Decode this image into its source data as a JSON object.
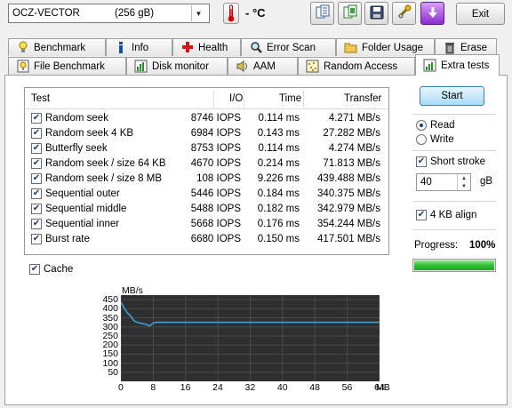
{
  "drive": {
    "name": "OCZ-VECTOR",
    "size": "(256 gB)"
  },
  "temperature": "- °C",
  "toolbar": {
    "icons": [
      "copy-text-icon",
      "copy-screenshot-icon",
      "save-icon",
      "options-icon",
      "download-icon"
    ],
    "exit_label": "Exit"
  },
  "tabs_row1": [
    "Benchmark",
    "Info",
    "Health",
    "Error Scan",
    "Folder Usage",
    "Erase"
  ],
  "tabs_row2": [
    "File Benchmark",
    "Disk monitor",
    "AAM",
    "Random Access",
    "Extra tests"
  ],
  "active_tab": "Extra tests",
  "table": {
    "headers": [
      "Test",
      "I/O",
      "Time",
      "Transfer"
    ],
    "rows": [
      {
        "checked": true,
        "name": "Random seek",
        "io": "8746 IOPS",
        "time": "0.114 ms",
        "transfer": "4.271 MB/s"
      },
      {
        "checked": true,
        "name": "Random seek 4 KB",
        "io": "6984 IOPS",
        "time": "0.143 ms",
        "transfer": "27.282 MB/s"
      },
      {
        "checked": true,
        "name": "Butterfly seek",
        "io": "8753 IOPS",
        "time": "0.114 ms",
        "transfer": "4.274 MB/s"
      },
      {
        "checked": true,
        "name": "Random seek / size 64 KB",
        "io": "4670 IOPS",
        "time": "0.214 ms",
        "transfer": "71.813 MB/s"
      },
      {
        "checked": true,
        "name": "Random seek / size 8 MB",
        "io": "108 IOPS",
        "time": "9.226 ms",
        "transfer": "439.488 MB/s"
      },
      {
        "checked": true,
        "name": "Sequential outer",
        "io": "5446 IOPS",
        "time": "0.184 ms",
        "transfer": "340.375 MB/s"
      },
      {
        "checked": true,
        "name": "Sequential middle",
        "io": "5488 IOPS",
        "time": "0.182 ms",
        "transfer": "342.979 MB/s"
      },
      {
        "checked": true,
        "name": "Sequential inner",
        "io": "5668 IOPS",
        "time": "0.176 ms",
        "transfer": "354.244 MB/s"
      },
      {
        "checked": true,
        "name": "Burst rate",
        "io": "6680 IOPS",
        "time": "0.150 ms",
        "transfer": "417.501 MB/s"
      }
    ]
  },
  "cache": {
    "label": "Cache",
    "checked": true
  },
  "controls": {
    "start_label": "Start",
    "read_label": "Read",
    "write_label": "Write",
    "mode": "read",
    "short_stroke_label": "Short stroke",
    "short_stroke_checked": true,
    "short_stroke_value": "40",
    "short_stroke_unit": "gB",
    "align_label": "4 KB align",
    "align_checked": true,
    "progress_label": "Progress:",
    "progress_text": "100%",
    "progress": 1.0
  },
  "colors": {
    "accent": "#3c9fd8",
    "plot_bg": "#2f2f2f",
    "progress": "#30c030"
  },
  "chart_data": {
    "type": "line",
    "ylabel": "MB/s",
    "xunit": "MB",
    "yticks": [
      450,
      400,
      350,
      300,
      250,
      200,
      150,
      100,
      50
    ],
    "xticks": [
      0,
      8,
      16,
      24,
      32,
      40,
      48,
      56,
      64
    ],
    "xlim": [
      0,
      64
    ],
    "ylim": [
      0,
      475
    ],
    "grid": true,
    "series": [
      {
        "x": [
          0,
          0.3,
          0.8,
          1.5,
          2.5,
          3.0,
          3.5,
          4.5,
          5.5,
          6.5,
          7.0,
          7.5,
          8.0,
          9.0,
          12,
          16,
          24,
          32,
          40,
          48,
          56,
          64
        ],
        "y": [
          435,
          425,
          405,
          380,
          358,
          340,
          330,
          322,
          318,
          312,
          305,
          312,
          322,
          325,
          325,
          325,
          325,
          325,
          325,
          325,
          325,
          325
        ]
      }
    ]
  }
}
